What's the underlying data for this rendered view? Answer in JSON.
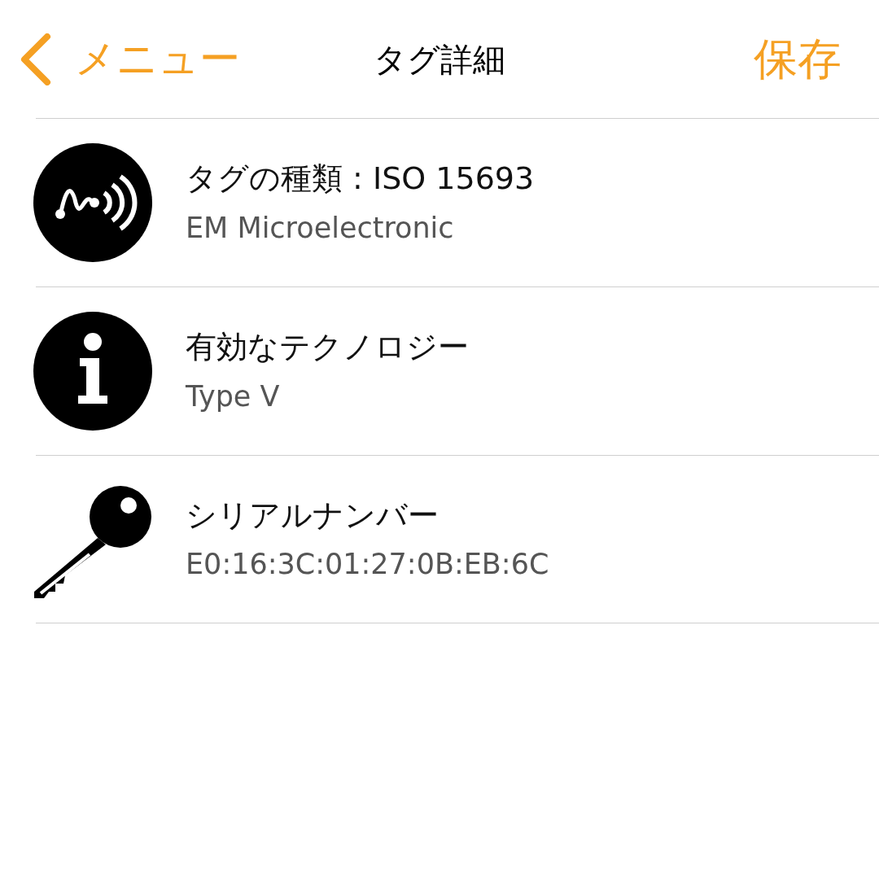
{
  "nav": {
    "back": "メニュー",
    "title": "タグ詳細",
    "action": "保存"
  },
  "rows": [
    {
      "kind": "tag",
      "title": "タグの種類 : ISO 15693",
      "subtitle": "EM Microelectronic"
    },
    {
      "kind": "info",
      "title": "有効なテクノロジー",
      "subtitle": "Type V"
    },
    {
      "kind": "key",
      "title": "シリアルナンバー",
      "subtitle": "E0:16:3C:01:27:0B:EB:6C"
    }
  ]
}
